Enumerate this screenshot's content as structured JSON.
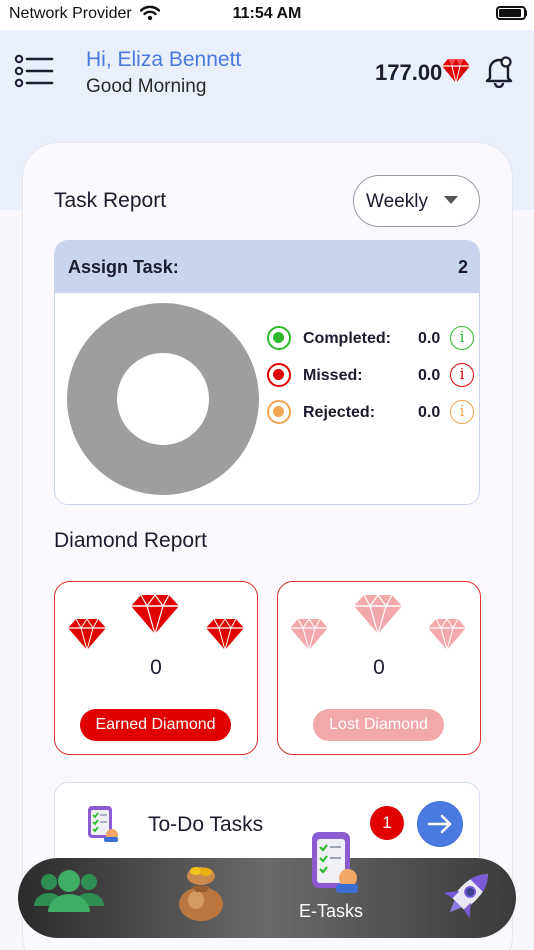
{
  "status_bar": {
    "carrier": "Network Provider",
    "time": "11:54 AM"
  },
  "header": {
    "greeting_name": "Hi, Eliza Bennett",
    "greeting_sub": "Good Morning",
    "balance": "177.00",
    "icons": [
      "menu-icon",
      "diamond-icon",
      "bell-icon"
    ]
  },
  "task_report": {
    "title": "Task Report",
    "period": "Weekly",
    "assign_label": "Assign Task:",
    "assign_count": "2",
    "legend": [
      {
        "label": "Completed:",
        "value": "0.0",
        "color": "#2db82d"
      },
      {
        "label": "Missed:",
        "value": "0.0",
        "color": "#e00000"
      },
      {
        "label": "Rejected:",
        "value": "0.0",
        "color": "#f0a550"
      }
    ],
    "donut_color": "#9e9e9e"
  },
  "diamond_report": {
    "title": "Diamond Report",
    "earned": {
      "value": "0",
      "label": "Earned Diamond",
      "color": "#e00000"
    },
    "lost": {
      "value": "0",
      "label": "Lost Diamond",
      "color": "#f3a9ab"
    }
  },
  "todo": {
    "label": "To-Do Tasks",
    "badge": "1"
  },
  "bottom_nav": {
    "items": [
      {
        "name": "users-icon"
      },
      {
        "name": "money-bag-icon"
      },
      {
        "name": "e-tasks-icon",
        "label": "E-Tasks"
      },
      {
        "name": "rocket-icon"
      }
    ]
  },
  "colors": {
    "accent": "#4a7ae0",
    "header_bg": "#e9f0fb",
    "assign_header": "#c9d4ef"
  }
}
